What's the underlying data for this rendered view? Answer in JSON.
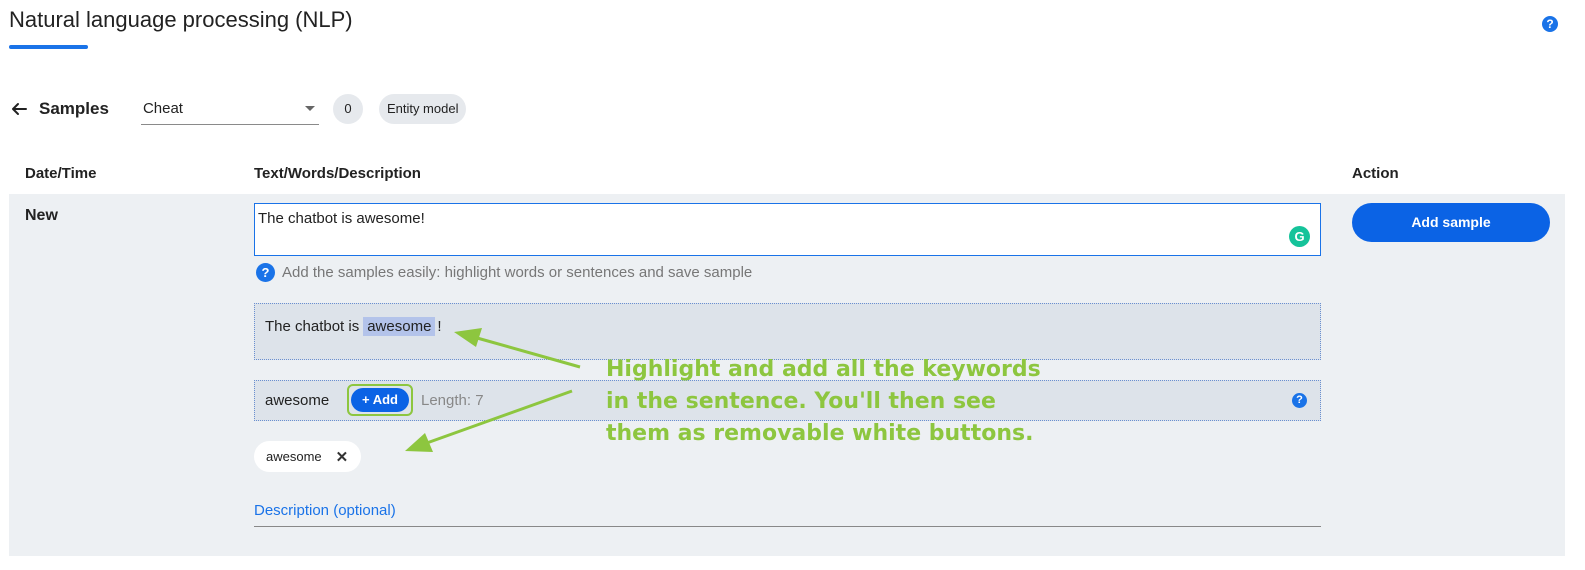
{
  "header": {
    "title": "Natural language processing (NLP)",
    "help_icon": "?"
  },
  "toolbar": {
    "back_icon": "arrow-left-icon",
    "samples_label": "Samples",
    "intent_select_value": "Cheat",
    "count": "0",
    "entity_model_label": "Entity model"
  },
  "table": {
    "columns": [
      "Date/Time",
      "Text/Words/Description",
      "Action"
    ],
    "row_label": "New"
  },
  "editor": {
    "input_value": "The chatbot is awesome!",
    "grammarly_glyph": "G",
    "hint_icon": "?",
    "hint_text": "Add the samples easily: highlight words or sentences and save sample",
    "highlight_before": "The chatbot is",
    "highlight_word": "awesome",
    "highlight_after": "!",
    "keyword_text": "awesome",
    "add_button_label": "+ Add",
    "length_label": "Length: 7",
    "keyword_help_icon": "?",
    "keyword_chip_label": "awesome",
    "keyword_chip_remove": "✕",
    "description_placeholder": "Description (optional)"
  },
  "action": {
    "add_sample_label": "Add sample"
  },
  "annotation": {
    "lines": [
      "Highlight and add all the keywords",
      "in the sentence. You'll then see",
      "them as removable white buttons."
    ],
    "color": "#8dc63f"
  },
  "colors": {
    "primary": "#0b63e5",
    "accent": "#1a73e8",
    "row_background": "#edf0f3"
  }
}
